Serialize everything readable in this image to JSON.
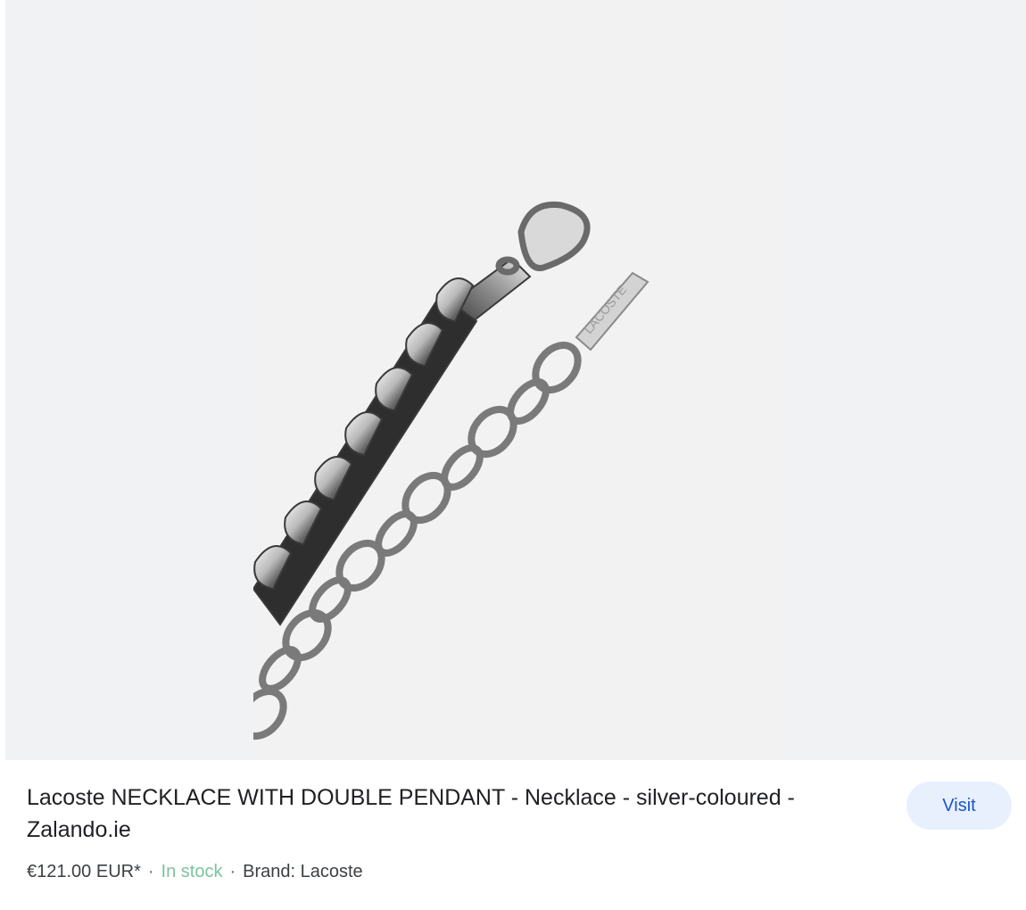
{
  "product": {
    "title": "Lacoste NECKLACE WITH DOUBLE PENDANT - Necklace - silver-coloured - Zalando.ie",
    "price": "€121.00 EUR*",
    "separator": "·",
    "stock_status": "In stock",
    "brand": "Brand: Lacoste",
    "tag_engraving": "LACOSTE"
  },
  "actions": {
    "visit_label": "Visit"
  },
  "colors": {
    "visit_bg": "#e8f0fe",
    "visit_text": "#1a56c6",
    "in_stock": "#7cc3a0",
    "image_bg": "#f1f2f4"
  },
  "icons": {
    "product_image": "necklace-photo"
  }
}
